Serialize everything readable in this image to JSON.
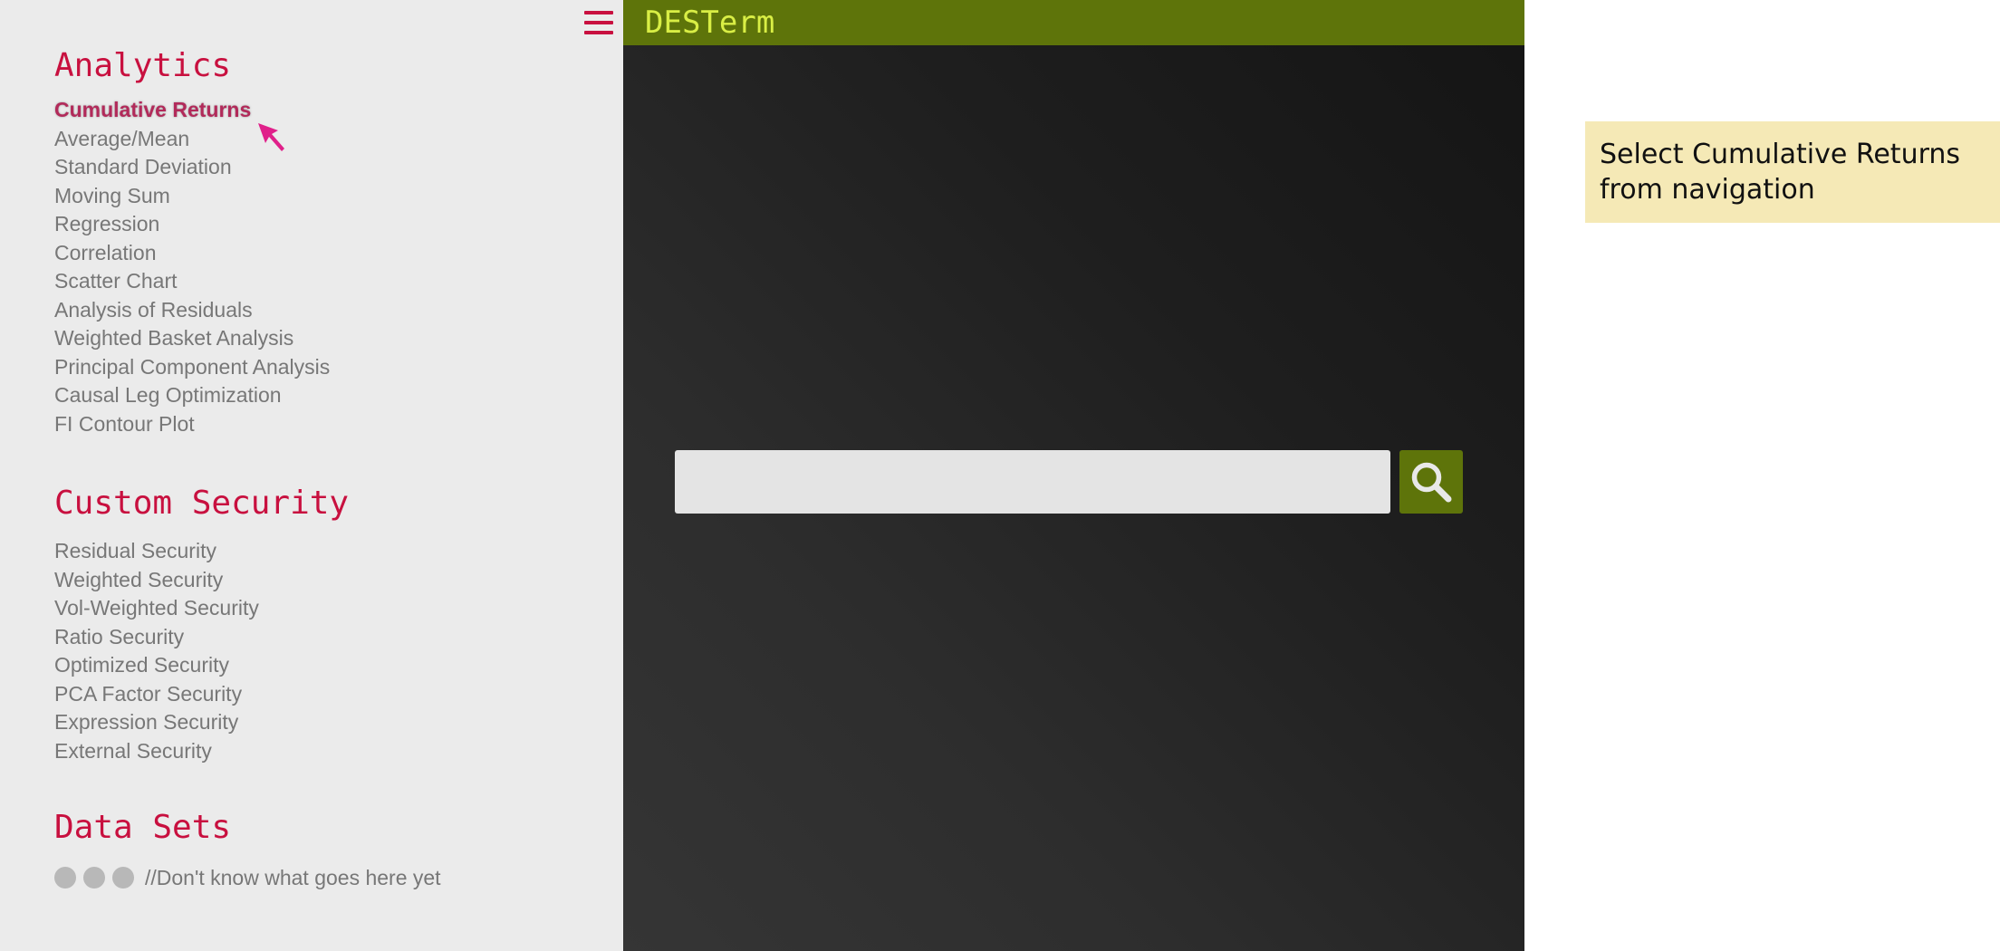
{
  "sidebar": {
    "sections": {
      "analytics": {
        "heading": "Analytics",
        "items": [
          {
            "label": "Cumulative Returns",
            "active": true
          },
          {
            "label": "Average/Mean"
          },
          {
            "label": "Standard Deviation"
          },
          {
            "label": "Moving Sum"
          },
          {
            "label": "Regression"
          },
          {
            "label": "Correlation"
          },
          {
            "label": "Scatter Chart"
          },
          {
            "label": "Analysis of Residuals"
          },
          {
            "label": "Weighted Basket Analysis"
          },
          {
            "label": "Principal Component Analysis"
          },
          {
            "label": "Causal Leg Optimization"
          },
          {
            "label": "FI Contour Plot"
          }
        ]
      },
      "custom_security": {
        "heading": "Custom Security",
        "items": [
          {
            "label": "Residual Security"
          },
          {
            "label": "Weighted Security"
          },
          {
            "label": "Vol-Weighted Security"
          },
          {
            "label": "Ratio Security"
          },
          {
            "label": "Optimized Security"
          },
          {
            "label": "PCA Factor Security"
          },
          {
            "label": "Expression Security"
          },
          {
            "label": "External Security"
          }
        ]
      },
      "data_sets": {
        "heading": "Data Sets",
        "placeholder_text": "//Don't know what goes here yet"
      }
    },
    "menu_icon": "hamburger-menu-icon"
  },
  "terminal": {
    "title": "DESTerm",
    "search": {
      "value": "",
      "placeholder": "",
      "button_icon": "magnifier-icon"
    }
  },
  "instruction": {
    "text": "Select Cumulative Returns from navigation"
  },
  "colors": {
    "accent": "#c8103f",
    "titlebar": "#5e740a",
    "title_text": "#d9ee45",
    "note_bg": "#f5e9b6",
    "sidebar_bg": "#ebebeb"
  }
}
